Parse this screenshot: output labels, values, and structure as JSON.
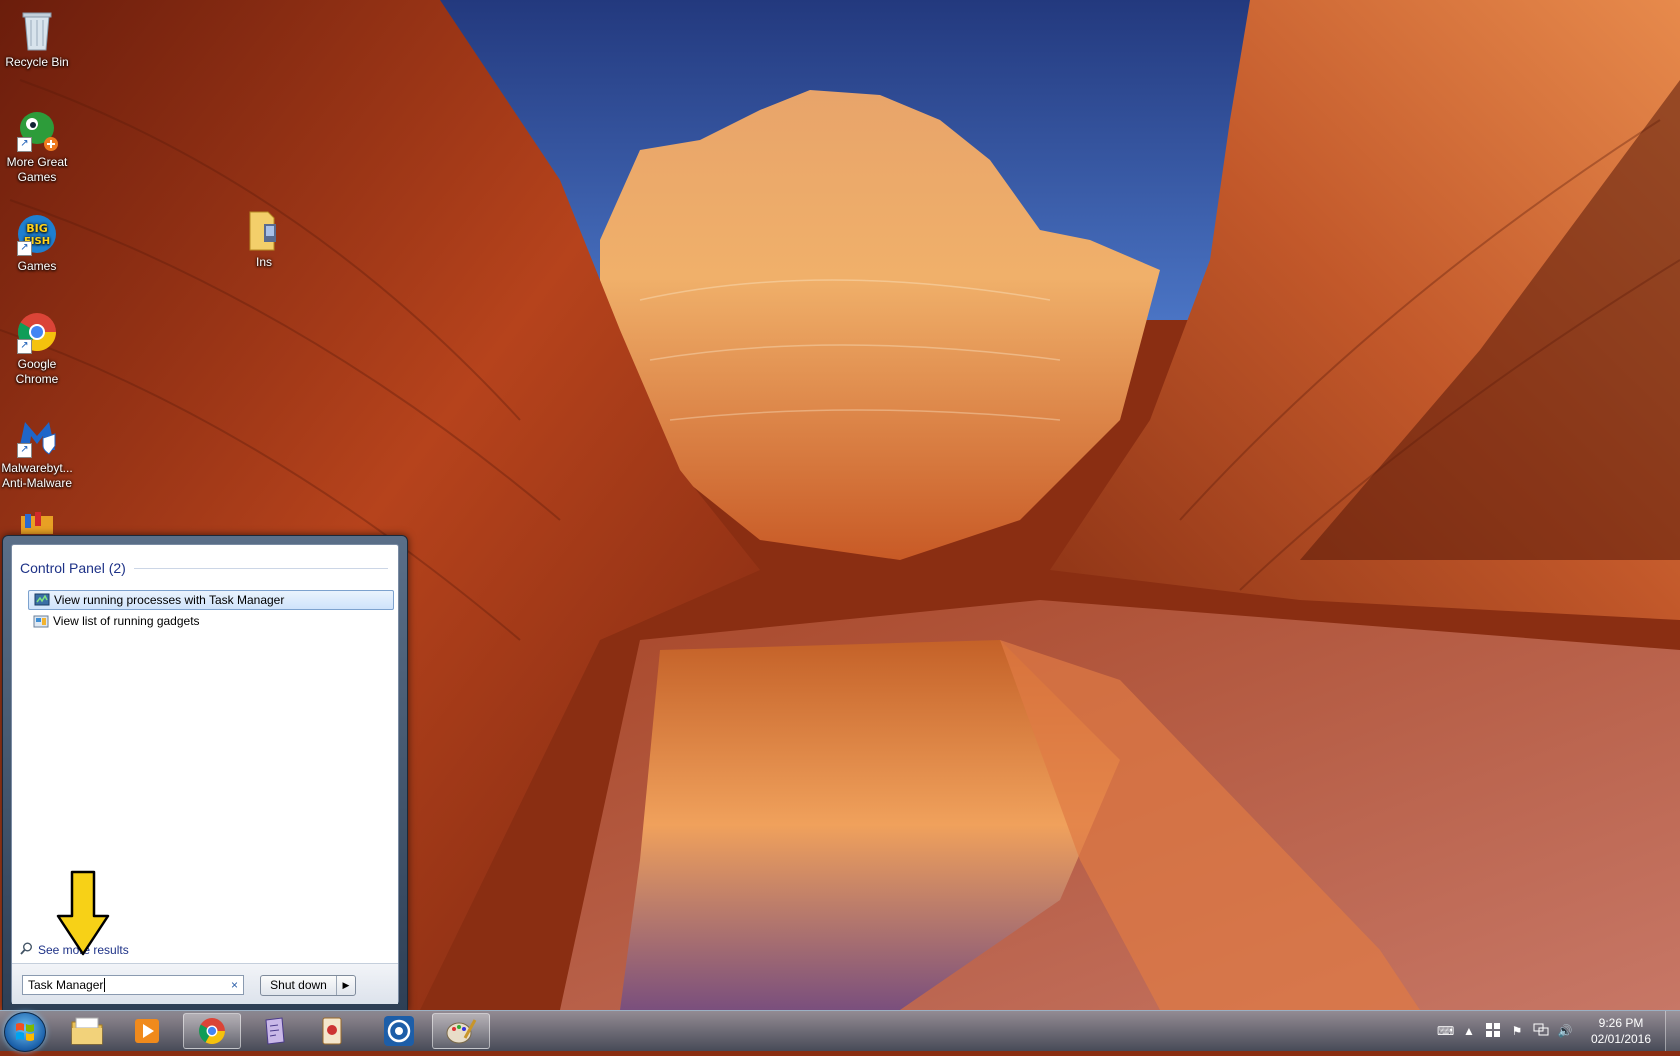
{
  "desktop": {
    "icons": [
      {
        "label": "Recycle Bin"
      },
      {
        "label": "More Great Games"
      },
      {
        "label": "Games"
      },
      {
        "label": "Google Chrome"
      },
      {
        "label": "Malwarebyt... Anti-Malware"
      },
      {
        "label": "Ins"
      }
    ]
  },
  "start_menu": {
    "group_header": "Control Panel (2)",
    "results": [
      {
        "label": "View running processes with Task Manager",
        "icon": "task-manager-icon",
        "selected": true
      },
      {
        "label": "View list of running gadgets",
        "icon": "gadgets-icon",
        "selected": false
      }
    ],
    "see_more": "See more results",
    "search": {
      "value": "Task Manager",
      "clear_symbol": "×"
    },
    "shutdown_label": "Shut down"
  },
  "taskbar": {
    "pinned": [
      "windows-explorer-icon",
      "media-player-icon",
      "chrome-icon",
      "app-icon",
      "game-icon",
      "security-icon",
      "paint-icon"
    ],
    "tray": {
      "time": "9:26 PM",
      "date": "02/01/2016"
    }
  },
  "colors": {
    "accent": "#1e3287",
    "selection": "#cfe3fb",
    "annotation": "#f7d117"
  }
}
